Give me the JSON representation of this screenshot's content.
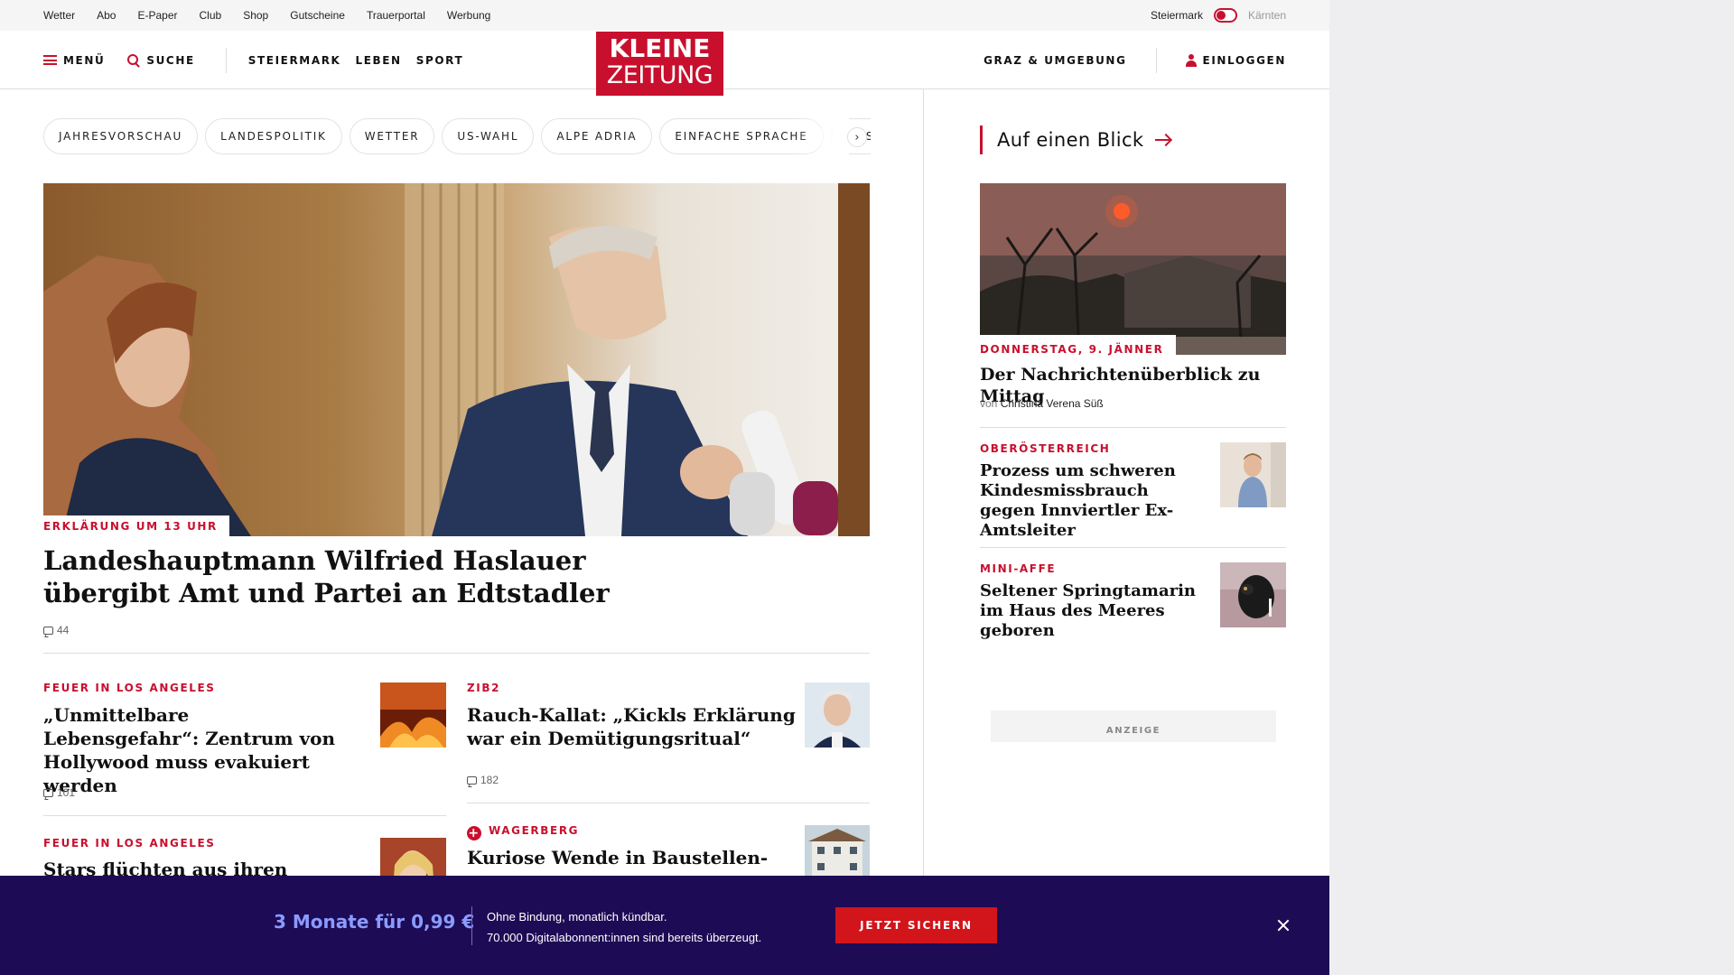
{
  "util": {
    "links": [
      "Wetter",
      "Abo",
      "E-Paper",
      "Club",
      "Shop",
      "Gutscheine",
      "Trauerportal",
      "Werbung"
    ],
    "region_active": "Steiermark",
    "region_other": "Kärnten"
  },
  "header": {
    "menu_label": "MENÜ",
    "search_label": "SUCHE",
    "nav": [
      "STEIERMARK",
      "LEBEN",
      "SPORT"
    ],
    "logo_line1": "KLEINE",
    "logo_line2": "ZEITUNG",
    "local_label": "GRAZ & UMGEBUNG",
    "login_label": "EINLOGGEN"
  },
  "chips": [
    "JAHRESVORSCHAU",
    "LANDESPOLITIK",
    "WETTER",
    "US-WAHL",
    "ALPE ADRIA",
    "EINFACHE SPRACHE",
    "DOS"
  ],
  "lead": {
    "kicker": "ERKLÄRUNG UM 13 UHR",
    "title": "Landeshauptmann Wilfried Haslauer übergibt Amt und Partei an Edtstadler",
    "comments": "44"
  },
  "teasers": [
    {
      "kicker": "FEUER IN LOS ANGELES",
      "title": "„Unmittelbare Lebensgefahr“: Zentrum von Hollywood muss evakuiert werden",
      "comments": "101"
    },
    {
      "kicker": "ZIB2",
      "title": "Rauch-Kallat: „Kickls Erklärung war ein Demütigungsritual“",
      "comments": "182"
    },
    {
      "kicker": "FEUER IN LOS ANGELES",
      "title": "Stars flüchten aus ihren"
    },
    {
      "kicker": "WAGERBERG",
      "title": "Kuriose Wende in Baustellen-"
    }
  ],
  "sidebar": {
    "heading": "Auf einen Blick",
    "main": {
      "date": "DONNERSTAG, 9. JÄNNER",
      "title": "Der Nachrichtenüberblick zu Mittag",
      "by": "von",
      "author": "Christina Verena Süß"
    },
    "items": [
      {
        "kicker": "OBERÖSTERREICH",
        "title": "Prozess um schweren Kindesmissbrauch gegen Innviertler Ex-Amtsleiter"
      },
      {
        "kicker": "MINI-AFFE",
        "title": "Seltener Springtamarin im Haus des Meeres geboren"
      }
    ],
    "ad_label": "ANZEIGE"
  },
  "promo": {
    "price": "3 Monate für 0,99 €",
    "line1": "Ohne Bindung, monatlich kündbar.",
    "line2": "70.000 Digitalabonnent:innen sind bereits überzeugt.",
    "cta": "JETZT SICHERN"
  },
  "colors": {
    "brand_red": "#c8102e",
    "promo_bg": "#1d0b55",
    "promo_price": "#8b9bff",
    "cta_red": "#d2141b"
  }
}
